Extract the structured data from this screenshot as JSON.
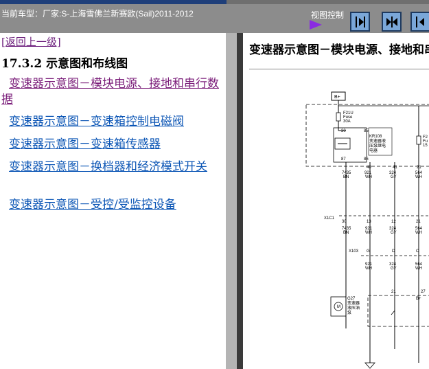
{
  "header": {
    "car_label": "当前车型：厂家:S-上海雪佛兰新赛欧(Sail)2011-2012",
    "view_control": "视图控制"
  },
  "toolbar": {
    "buttons": [
      "next-page-icon",
      "split-view-icon",
      "prev-page-icon"
    ]
  },
  "nav": {
    "back_link": "[返回上一级]",
    "section_title": "17.3.2  示意图和布线图",
    "links": [
      "变速器示意图－模块电源、接地和串行数据",
      "变速器示意图－变速箱控制电磁阀",
      "变速器示意图－变速箱传感器",
      "变速器示意图－换档器和经济模式开关",
      "变速器示意图－受控/受监控设备"
    ]
  },
  "content": {
    "title": "变速器示意图－模块电源、接地和串行数据",
    "diagram": {
      "battery": "B+",
      "fuse1": "F21U",
      "fuse1_sub": "Fuse",
      "fuse1_rating": "30A",
      "fuse2": "F2",
      "fuse2_sub": "Fu",
      "fuse2_rating": "15",
      "relay_id": "KR108",
      "relay_name1": "变速器液",
      "relay_name2": "压泵继电",
      "relay_name3": "电器",
      "relay_pins": [
        "30",
        "85",
        "87",
        "86"
      ],
      "wires_top": [
        {
          "pin": "",
          "code": "7435",
          "color": "BN"
        },
        {
          "pin": "40",
          "code": "921",
          "color": "WH"
        },
        {
          "pin": "41",
          "code": "324",
          "color": "GY"
        },
        {
          "pin": "21",
          "code": "564",
          "color": "WH"
        }
      ],
      "conn1": "X1C1",
      "conn1_pins": [
        "30",
        "13",
        "12",
        "21"
      ],
      "wires_mid": [
        {
          "code": "7435",
          "color": "BN"
        },
        {
          "code": "921",
          "color": "WH"
        },
        {
          "code": "324",
          "color": "GY"
        },
        {
          "code": "564",
          "color": "WH"
        }
      ],
      "conn2": "X103",
      "conn2_pins": [
        "G",
        "D",
        "C"
      ],
      "wires_low": [
        {
          "code": "921",
          "color": "WH"
        },
        {
          "code": "324",
          "color": "GY"
        },
        {
          "code": "564",
          "color": "WH"
        }
      ],
      "motor_id": "G27",
      "motor_name1": "变速器",
      "motor_name2": "液压油",
      "motor_name3": "泵",
      "module_pins": [
        "21",
        "B+",
        "27"
      ]
    }
  }
}
